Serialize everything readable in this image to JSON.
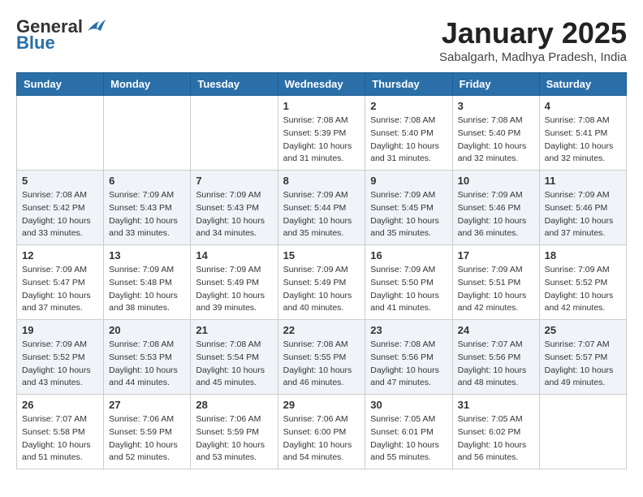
{
  "header": {
    "logo_general": "General",
    "logo_blue": "Blue",
    "month_title": "January 2025",
    "subtitle": "Sabalgarh, Madhya Pradesh, India"
  },
  "weekdays": [
    "Sunday",
    "Monday",
    "Tuesday",
    "Wednesday",
    "Thursday",
    "Friday",
    "Saturday"
  ],
  "weeks": [
    [
      {
        "day": "",
        "info": ""
      },
      {
        "day": "",
        "info": ""
      },
      {
        "day": "",
        "info": ""
      },
      {
        "day": "1",
        "info": "Sunrise: 7:08 AM\nSunset: 5:39 PM\nDaylight: 10 hours\nand 31 minutes."
      },
      {
        "day": "2",
        "info": "Sunrise: 7:08 AM\nSunset: 5:40 PM\nDaylight: 10 hours\nand 31 minutes."
      },
      {
        "day": "3",
        "info": "Sunrise: 7:08 AM\nSunset: 5:40 PM\nDaylight: 10 hours\nand 32 minutes."
      },
      {
        "day": "4",
        "info": "Sunrise: 7:08 AM\nSunset: 5:41 PM\nDaylight: 10 hours\nand 32 minutes."
      }
    ],
    [
      {
        "day": "5",
        "info": "Sunrise: 7:08 AM\nSunset: 5:42 PM\nDaylight: 10 hours\nand 33 minutes."
      },
      {
        "day": "6",
        "info": "Sunrise: 7:09 AM\nSunset: 5:43 PM\nDaylight: 10 hours\nand 33 minutes."
      },
      {
        "day": "7",
        "info": "Sunrise: 7:09 AM\nSunset: 5:43 PM\nDaylight: 10 hours\nand 34 minutes."
      },
      {
        "day": "8",
        "info": "Sunrise: 7:09 AM\nSunset: 5:44 PM\nDaylight: 10 hours\nand 35 minutes."
      },
      {
        "day": "9",
        "info": "Sunrise: 7:09 AM\nSunset: 5:45 PM\nDaylight: 10 hours\nand 35 minutes."
      },
      {
        "day": "10",
        "info": "Sunrise: 7:09 AM\nSunset: 5:46 PM\nDaylight: 10 hours\nand 36 minutes."
      },
      {
        "day": "11",
        "info": "Sunrise: 7:09 AM\nSunset: 5:46 PM\nDaylight: 10 hours\nand 37 minutes."
      }
    ],
    [
      {
        "day": "12",
        "info": "Sunrise: 7:09 AM\nSunset: 5:47 PM\nDaylight: 10 hours\nand 37 minutes."
      },
      {
        "day": "13",
        "info": "Sunrise: 7:09 AM\nSunset: 5:48 PM\nDaylight: 10 hours\nand 38 minutes."
      },
      {
        "day": "14",
        "info": "Sunrise: 7:09 AM\nSunset: 5:49 PM\nDaylight: 10 hours\nand 39 minutes."
      },
      {
        "day": "15",
        "info": "Sunrise: 7:09 AM\nSunset: 5:49 PM\nDaylight: 10 hours\nand 40 minutes."
      },
      {
        "day": "16",
        "info": "Sunrise: 7:09 AM\nSunset: 5:50 PM\nDaylight: 10 hours\nand 41 minutes."
      },
      {
        "day": "17",
        "info": "Sunrise: 7:09 AM\nSunset: 5:51 PM\nDaylight: 10 hours\nand 42 minutes."
      },
      {
        "day": "18",
        "info": "Sunrise: 7:09 AM\nSunset: 5:52 PM\nDaylight: 10 hours\nand 42 minutes."
      }
    ],
    [
      {
        "day": "19",
        "info": "Sunrise: 7:09 AM\nSunset: 5:52 PM\nDaylight: 10 hours\nand 43 minutes."
      },
      {
        "day": "20",
        "info": "Sunrise: 7:08 AM\nSunset: 5:53 PM\nDaylight: 10 hours\nand 44 minutes."
      },
      {
        "day": "21",
        "info": "Sunrise: 7:08 AM\nSunset: 5:54 PM\nDaylight: 10 hours\nand 45 minutes."
      },
      {
        "day": "22",
        "info": "Sunrise: 7:08 AM\nSunset: 5:55 PM\nDaylight: 10 hours\nand 46 minutes."
      },
      {
        "day": "23",
        "info": "Sunrise: 7:08 AM\nSunset: 5:56 PM\nDaylight: 10 hours\nand 47 minutes."
      },
      {
        "day": "24",
        "info": "Sunrise: 7:07 AM\nSunset: 5:56 PM\nDaylight: 10 hours\nand 48 minutes."
      },
      {
        "day": "25",
        "info": "Sunrise: 7:07 AM\nSunset: 5:57 PM\nDaylight: 10 hours\nand 49 minutes."
      }
    ],
    [
      {
        "day": "26",
        "info": "Sunrise: 7:07 AM\nSunset: 5:58 PM\nDaylight: 10 hours\nand 51 minutes."
      },
      {
        "day": "27",
        "info": "Sunrise: 7:06 AM\nSunset: 5:59 PM\nDaylight: 10 hours\nand 52 minutes."
      },
      {
        "day": "28",
        "info": "Sunrise: 7:06 AM\nSunset: 5:59 PM\nDaylight: 10 hours\nand 53 minutes."
      },
      {
        "day": "29",
        "info": "Sunrise: 7:06 AM\nSunset: 6:00 PM\nDaylight: 10 hours\nand 54 minutes."
      },
      {
        "day": "30",
        "info": "Sunrise: 7:05 AM\nSunset: 6:01 PM\nDaylight: 10 hours\nand 55 minutes."
      },
      {
        "day": "31",
        "info": "Sunrise: 7:05 AM\nSunset: 6:02 PM\nDaylight: 10 hours\nand 56 minutes."
      },
      {
        "day": "",
        "info": ""
      }
    ]
  ]
}
